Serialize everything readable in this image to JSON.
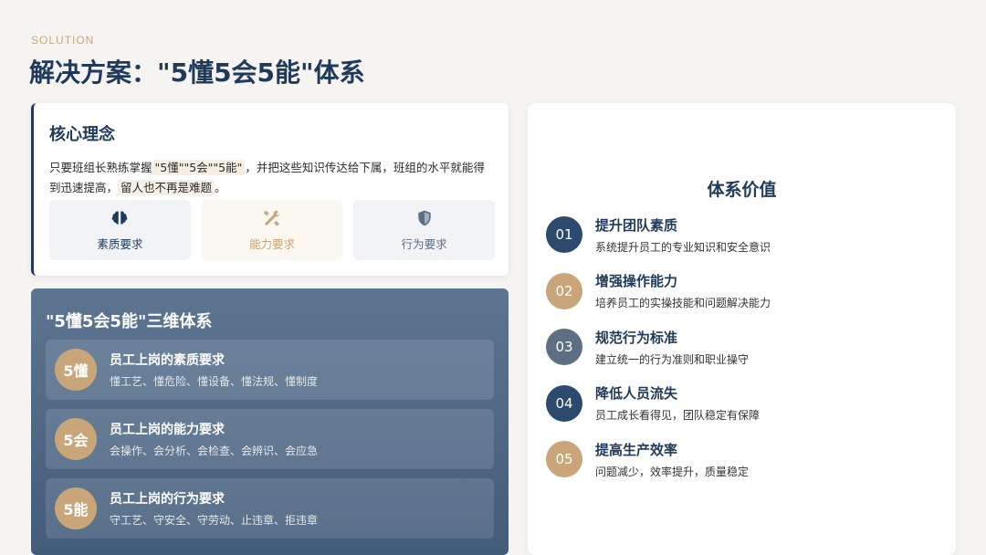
{
  "header": {
    "eyebrow": "SOLUTION",
    "title": "解决方案：\"5懂5会5能\"体系"
  },
  "concept": {
    "title": "核心理念",
    "text_part1": "只要班组长熟练掌握",
    "highlight1": "\"5懂\"\"5会\"\"5能\"",
    "text_part2": "，并把这些知识传达给下属，班组的水平就能得到迅速提高，",
    "highlight2": "留人也不再是难题",
    "text_part3": "。",
    "pillars": [
      {
        "label": "素质要求",
        "icon": "brain-icon"
      },
      {
        "label": "能力要求",
        "icon": "tools-icon"
      },
      {
        "label": "行为要求",
        "icon": "shield-icon"
      }
    ]
  },
  "dimensions": {
    "title": "\"5懂5会5能\"三维体系",
    "rows": [
      {
        "badge": "5懂",
        "head": "员工上岗的素质要求",
        "sub": "懂工艺、懂危险、懂设备、懂法规、懂制度"
      },
      {
        "badge": "5会",
        "head": "员工上岗的能力要求",
        "sub": "会操作、会分析、会检查、会辨识、会应急"
      },
      {
        "badge": "5能",
        "head": "员工上岗的行为要求",
        "sub": "守工艺、守安全、守劳动、止违章、拒违章"
      }
    ]
  },
  "values": {
    "title": "体系价值",
    "items": [
      {
        "num": "01",
        "head": "提升团队素质",
        "sub": "系统提升员工的专业知识和安全意识",
        "color": "#2b4a6e"
      },
      {
        "num": "02",
        "head": "增强操作能力",
        "sub": "培养员工的实操技能和问题解决能力",
        "color": "#c9a57a"
      },
      {
        "num": "03",
        "head": "规范行为标准",
        "sub": "建立统一的行为准则和职业操守",
        "color": "#5e6f85"
      },
      {
        "num": "04",
        "head": "降低人员流失",
        "sub": "员工成长看得见，团队稳定有保障",
        "color": "#2b4a6e"
      },
      {
        "num": "05",
        "head": "提高生产效率",
        "sub": "问题减少，效率提升，质量稳定",
        "color": "#c9a57a"
      }
    ]
  },
  "colors": {
    "navy": "#1f3a5a",
    "gold": "#c9a57a",
    "slate": "#5e6f85",
    "background": "#f6f4f0"
  }
}
